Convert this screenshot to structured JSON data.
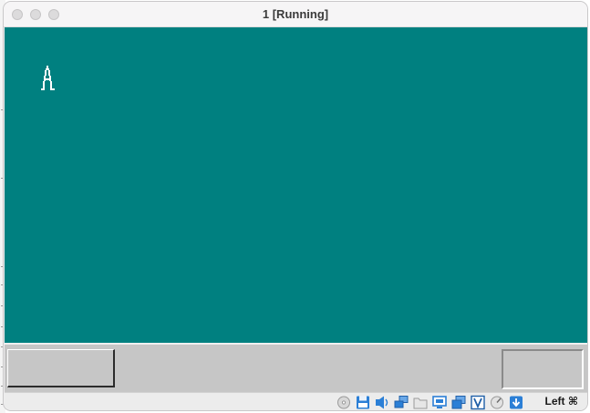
{
  "window": {
    "title": "1 [Running]"
  },
  "guest": {
    "background_color": "#008080",
    "desktop_icon": "compass-icon"
  },
  "statusbar": {
    "icons": [
      "optical-drive-icon",
      "floppy-disk-icon",
      "audio-icon",
      "network-icon",
      "shared-folder-icon",
      "display-icon",
      "video-capture-icon",
      "virtualization-icon",
      "mouse-integration-icon",
      "keyboard-capture-icon"
    ],
    "host_key_label": "Left ⌘"
  }
}
